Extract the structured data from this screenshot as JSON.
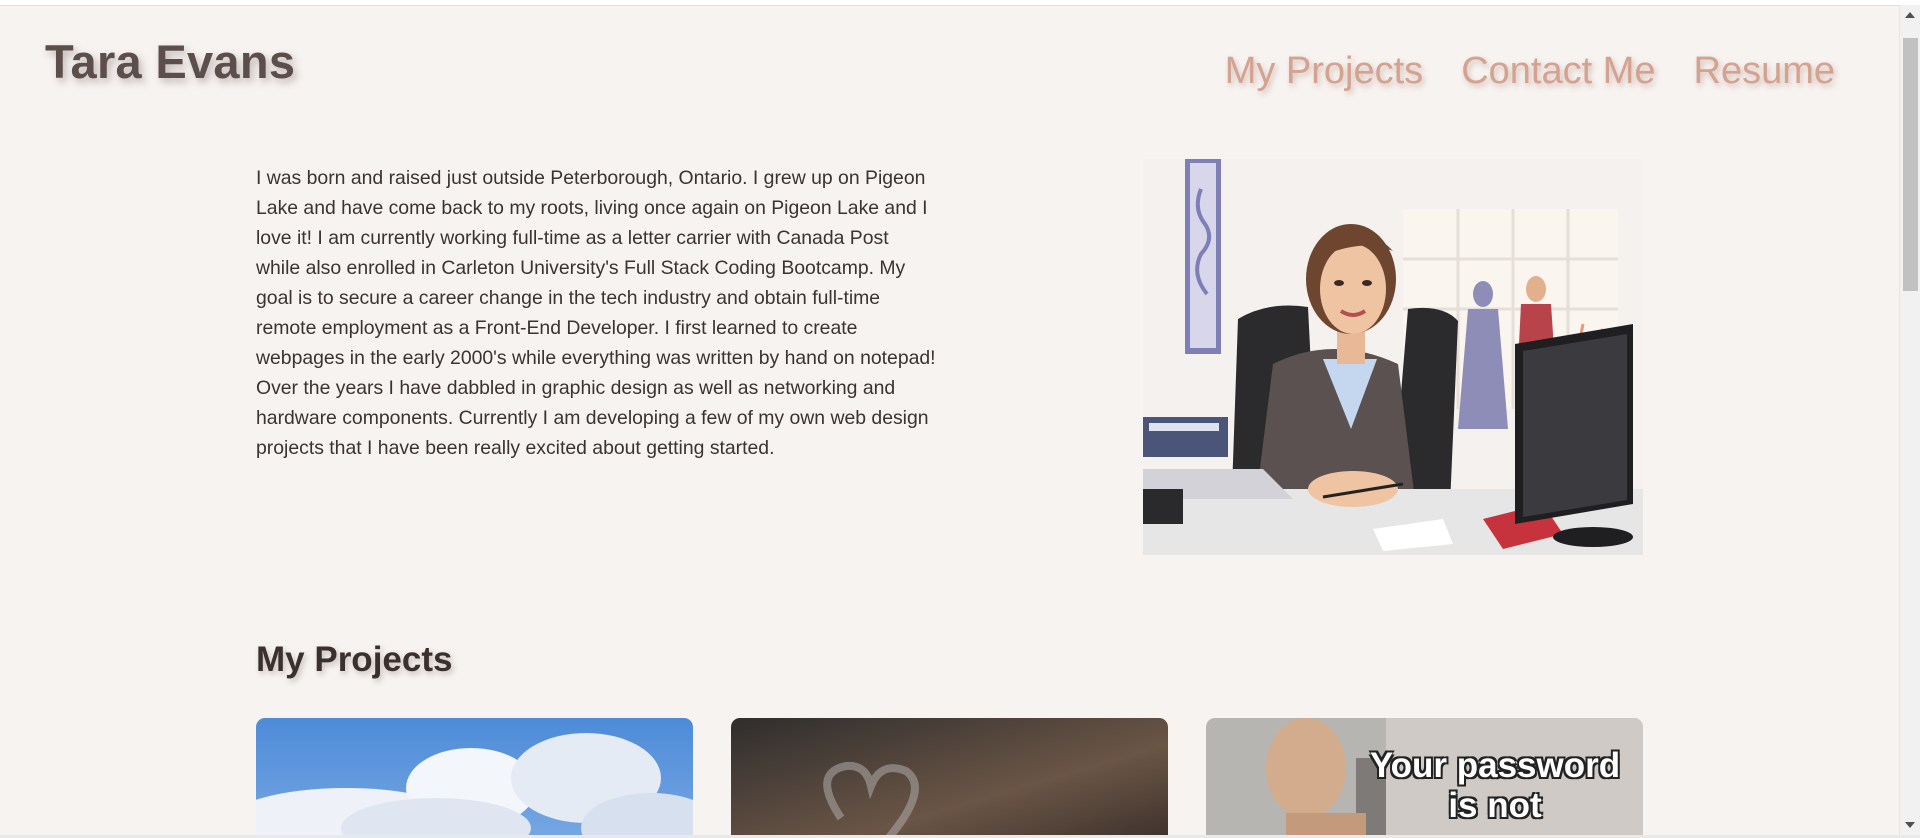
{
  "header": {
    "title": "Tara Evans",
    "nav": [
      "My Projects",
      "Contact Me",
      "Resume"
    ]
  },
  "about": {
    "text": "I was born and raised just outside Peterborough, Ontario. I grew up on Pigeon Lake and have come back to my roots, living once again on Pigeon Lake and I love it! I am currently working full-time as a letter carrier with Canada Post while also enrolled in Carleton University's Full Stack Coding Bootcamp. My goal is to secure a career change in the tech industry and obtain full-time remote employment as a Front-End Developer. I first learned to create webpages in the early 2000's while everything was written by hand on notepad! Over the years I have dabbled in graphic design as well as networking and hardware components. Currently I am developing a few of my own web design projects that I have been really excited about getting started."
  },
  "projects": {
    "title": "My Projects",
    "cards": [
      {
        "image": "sky-clouds"
      },
      {
        "image": "heart-smoke"
      },
      {
        "image": "meme",
        "caption": "Your password is not"
      }
    ]
  },
  "colors": {
    "background": "#f7f3f1",
    "title": "#5c4e4a",
    "nav_link": "#d4a290"
  }
}
